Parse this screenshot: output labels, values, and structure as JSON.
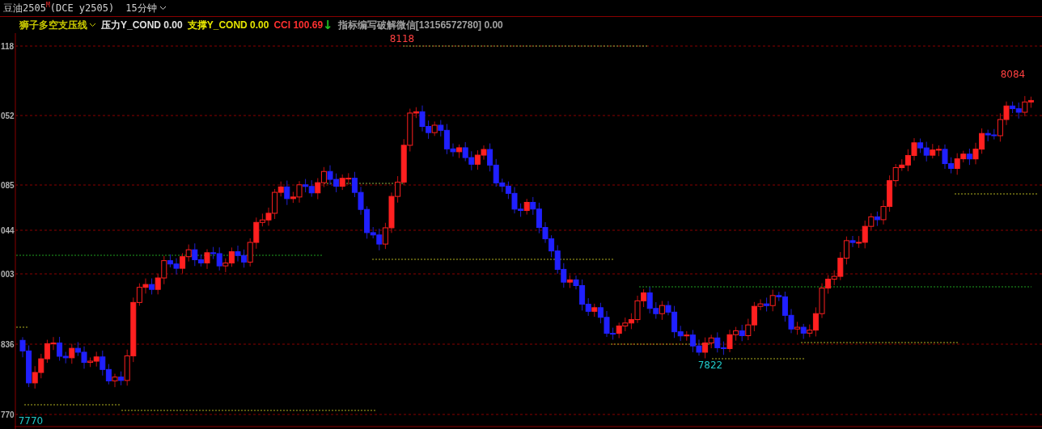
{
  "header": {
    "symbol": "豆油2505",
    "symbol_mark": "M",
    "code": "(DCE y2505)",
    "period": "15分钟"
  },
  "indicator_bar": [
    {
      "text": "狮子多空支压线",
      "color": "#c8c800",
      "dropdown": true
    },
    {
      "text": "压力Y_COND 0.00",
      "color": "#e0e0e0",
      "dropdown": false
    },
    {
      "text": "支撑Y_COND 0.00",
      "color": "#e6e600",
      "dropdown": false
    },
    {
      "text": "CCI 100.69",
      "color": "#ff3030",
      "dropdown": false
    },
    {
      "text": "↓",
      "color": "#20c020",
      "dropdown": false,
      "kind": "arrow"
    },
    {
      "text": "指标编写破解微信[13156572780] 0.00",
      "color": "#a0a0a0",
      "dropdown": false
    }
  ],
  "price_axis": [
    "118",
    "052",
    "085",
    "044",
    "003",
    "836",
    "770"
  ],
  "price_labels": [
    {
      "text": "8118",
      "kind": "high"
    },
    {
      "text": "8084",
      "kind": "high"
    },
    {
      "text": "7822",
      "kind": "low"
    },
    {
      "text": "7770",
      "kind": "low"
    }
  ]
}
